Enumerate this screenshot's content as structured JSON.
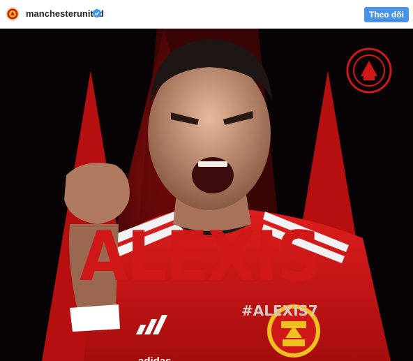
{
  "header": {
    "username": "manchesterunited",
    "follow_label": "Theo dõi"
  },
  "media": {
    "headline": "ALEXIS",
    "hashtag": "#ALEXIS7",
    "kit_brand": "adidas"
  },
  "colors": {
    "follow_button": "#4a94e8",
    "club_red": "#d01818",
    "background": "#0a0506"
  }
}
